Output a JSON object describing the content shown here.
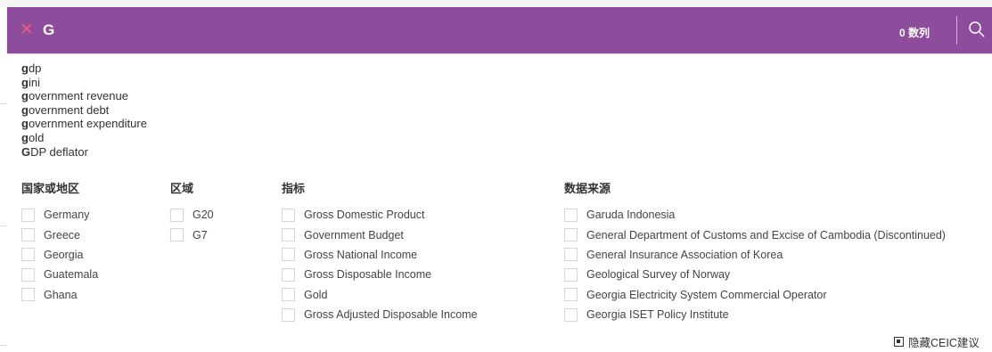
{
  "search": {
    "query": "G",
    "count_label": "0 数列",
    "close_icon": "close-icon",
    "search_icon": "search-icon",
    "bar_color": "#8e4c9c",
    "close_color": "#f05a78"
  },
  "suggestions": [
    {
      "match": "g",
      "rest": "dp"
    },
    {
      "match": "g",
      "rest": "ini"
    },
    {
      "match": "g",
      "rest": "overnment revenue"
    },
    {
      "match": "g",
      "rest": "overnment debt"
    },
    {
      "match": "g",
      "rest": "overnment expenditure"
    },
    {
      "match": "g",
      "rest": "old"
    },
    {
      "match": "G",
      "rest": "DP deflator"
    }
  ],
  "columns": {
    "countries": {
      "title": "国家或地区",
      "items": [
        "Germany",
        "Greece",
        "Georgia",
        "Guatemala",
        "Ghana"
      ]
    },
    "regions": {
      "title": "区域",
      "items": [
        "G20",
        "G7"
      ]
    },
    "indicators": {
      "title": "指标",
      "items": [
        "Gross Domestic Product",
        "Government Budget",
        "Gross National Income",
        "Gross Disposable Income",
        "Gold",
        "Gross Adjusted Disposable Income"
      ]
    },
    "sources": {
      "title": "数据来源",
      "items": [
        "Garuda Indonesia",
        "General Department of Customs and Excise of Cambodia (Discontinued)",
        "General Insurance Association of Korea",
        "Geological Survey of Norway",
        "Georgia Electricity System Commercial Operator",
        "Georgia ISET Policy Institute"
      ]
    }
  },
  "footer": {
    "hide_label": "隐藏CEIC建议",
    "hide_icon": "square-icon"
  }
}
